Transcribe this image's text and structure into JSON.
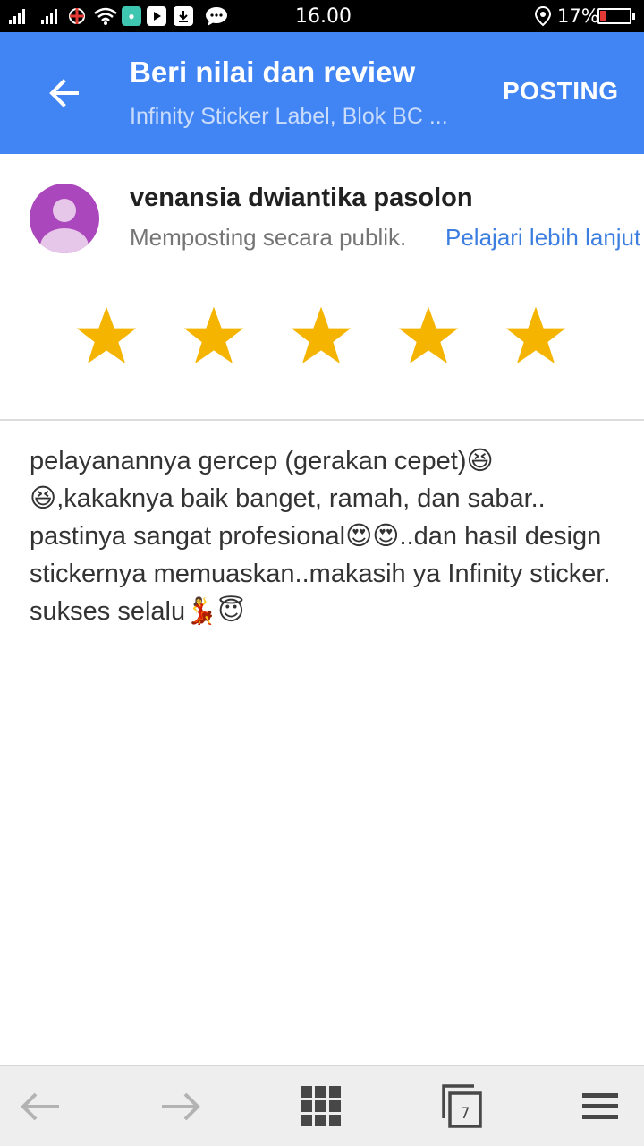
{
  "status_bar": {
    "time": "16.00",
    "battery_text": "17%",
    "battery_level": 0.17,
    "battery_color": "#e53935"
  },
  "header": {
    "title": "Beri nilai dan review",
    "subtitle": "Infinity Sticker Label, Blok BC ...",
    "post_label": "POSTING",
    "back_icon": "arrow-left-icon",
    "color": "#4185f4"
  },
  "user": {
    "name": "venansia dwiantika pasolon",
    "posting_text": "Memposting secara publik.",
    "learn_more": "Pelajari lebih lanjut",
    "avatar_color": "#ab47bc"
  },
  "rating": {
    "stars_filled": 5,
    "stars_total": 5,
    "star_color": "#f4b400"
  },
  "review": {
    "text": "pelayanannya gercep (gerakan cepet)😆😆,kakaknya baik banget, ramah, dan sabar.. pastinya sangat profesional😍😍..dan hasil design stickernya memuaskan..makasih ya Infinity sticker. sukses selalu💃😇"
  },
  "bottom_nav": {
    "tab_count": "7",
    "items": [
      "back-icon",
      "forward-icon",
      "apps-grid-icon",
      "tabs-icon",
      "menu-icon"
    ]
  }
}
